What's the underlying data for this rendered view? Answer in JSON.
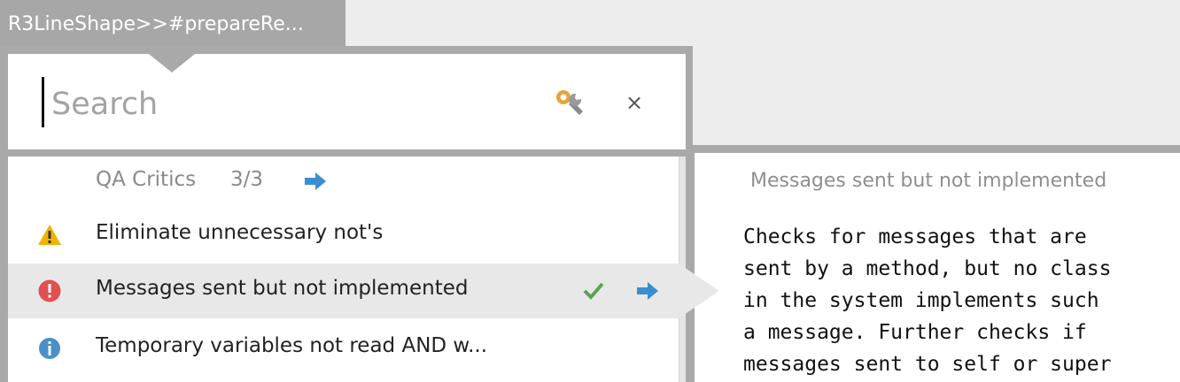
{
  "window": {
    "title": "R3LineShape>>#prepareRe..."
  },
  "search": {
    "placeholder": "Search",
    "value": ""
  },
  "group": {
    "title": "QA Critics",
    "count": "3/3"
  },
  "critics": [
    {
      "label": "Eliminate unnecessary not's",
      "severity": "warning-icon"
    },
    {
      "label": "Messages sent but not implemented",
      "severity": "error-icon",
      "selected": true
    },
    {
      "label": "Temporary variables not read AND w...",
      "severity": "info-icon"
    }
  ],
  "detail": {
    "title": "Messages sent but not implemented",
    "text": "Checks for messages that are\nsent by a method, but no class\nin the system implements such\na message. Further checks if\nmessages sent to self or super"
  },
  "colors": {
    "frame": "#a9a9a9",
    "warning": "#f0b400",
    "error": "#e05050",
    "info": "#4a90c8",
    "arrow": "#3a8fd0",
    "check": "#5aa552"
  }
}
